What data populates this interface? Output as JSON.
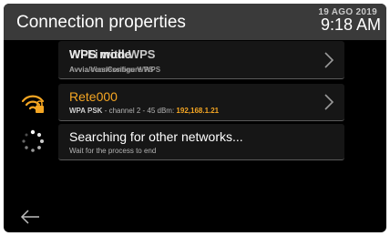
{
  "header": {
    "title": "Connection properties",
    "date": "19 AGO 2019",
    "time": "9:18 AM"
  },
  "rows": {
    "wps": {
      "label_a": "WPS mode",
      "label_b": "Wi-Fi with WPS",
      "sub_a": "Avvia/Vias/Configure WPS",
      "sub_b": "Avvia connessione WPS"
    },
    "network": {
      "ssid": "Rete000",
      "security": "WPA PSK",
      "details": "channel 2 - 45 dBm:",
      "ip": "192,168.1.21"
    },
    "search": {
      "label": "Searching for other networks...",
      "sub": "Wait for the process to end"
    }
  },
  "icons": {
    "wifi_locked": "wifi-locked-icon",
    "spinner": "loading-spinner-icon",
    "chevron": "chevron-right-icon",
    "back": "back-arrow-icon"
  },
  "colors": {
    "accent": "#f5a623",
    "header_bg": "#3a3a3a",
    "background": "#000000",
    "row_bg": "#161616"
  }
}
